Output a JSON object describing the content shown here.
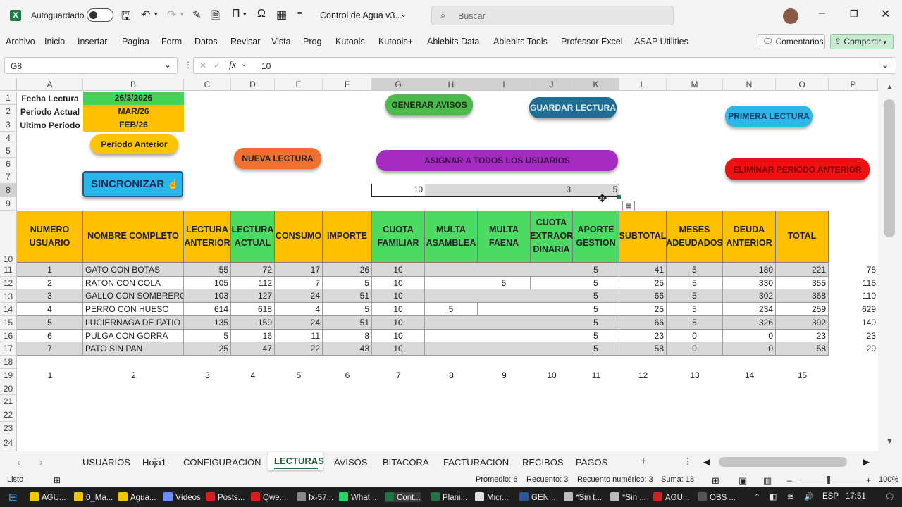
{
  "titlebar": {
    "autosave": "Autoguardado",
    "filename": "Control de Agua v3...",
    "search_placeholder": "Buscar"
  },
  "menu": [
    "Archivo",
    "Inicio",
    "Insertar",
    "Pagina",
    "Form",
    "Datos",
    "Revisar",
    "Vista",
    "Prog",
    "Kutools",
    "Kutools+",
    "Ablebits Data",
    "Ablebits Tools",
    "Professor Excel",
    "ASAP Utilities"
  ],
  "actions": {
    "comments": "Comentarios",
    "share": "Compartir"
  },
  "formula": {
    "cellref": "G8",
    "fx": "fx",
    "value": "10"
  },
  "columns": [
    "A",
    "B",
    "C",
    "D",
    "E",
    "F",
    "G",
    "H",
    "I",
    "J",
    "K",
    "L",
    "M",
    "N",
    "O",
    "P"
  ],
  "rows": [
    "1",
    "2",
    "3",
    "4",
    "5",
    "6",
    "7",
    "8",
    "9",
    "10",
    "11",
    "12",
    "13",
    "14",
    "15",
    "16",
    "17",
    "18",
    "19",
    "20",
    "21",
    "22",
    "23",
    "24"
  ],
  "info": {
    "fecha_label": "Fecha Lectura",
    "fecha": "26/3/2026",
    "periodo_label": "Periodo Actual",
    "periodo": "MAR/26",
    "ultimo_label": "Ultimo Periodo",
    "ultimo": "FEB/26"
  },
  "buttons": {
    "periodo_anterior": "Periodo Anterior",
    "sincronizar": "SINCRONIZAR",
    "nueva_lectura": "NUEVA LECTURA",
    "generar_avisos": "GENERAR AVISOS",
    "asignar": "ASIGNAR A TODOS LOS USUARIOS",
    "guardar": "GUARDAR LECTURA",
    "primera": "PRIMERA LECTURA",
    "eliminar": "ELIMINAR PERIODO ANTERIOR"
  },
  "row8": {
    "g": "10",
    "j": "3",
    "k": "5"
  },
  "headers": {
    "numero": "NUMERO USUARIO",
    "nombre": "NOMBRE COMPLETO",
    "anterior": "LECTURA ANTERIOR",
    "actual": "LECTURA ACTUAL",
    "consumo": "CONSUMO",
    "importe": "IMPORTE",
    "cuota": "CUOTA FAMILIAR",
    "multa_asamblea": "MULTA ASAMBLEA",
    "multa_faena": "MULTA FAENA",
    "cuota_extra": "CUOTA EXTRAOR DINARIA",
    "aporte": "APORTE GESTION",
    "subtotal": "SUBTOTAL",
    "meses": "MESES ADEUDADOS",
    "deuda": "DEUDA ANTERIOR",
    "total": "TOTAL"
  },
  "data": [
    {
      "n": "1",
      "nombre": "GATO CON BOTAS",
      "ant": "55",
      "act": "72",
      "cons": "17",
      "imp": "26",
      "cuota": "10",
      "masam": "",
      "mfaena": "",
      "cextra": "",
      "aporte": "5",
      "sub": "41",
      "meses": "5",
      "deuda": "180",
      "total": "221",
      "p": "78"
    },
    {
      "n": "2",
      "nombre": "RATON CON COLA",
      "ant": "105",
      "act": "112",
      "cons": "7",
      "imp": "5",
      "cuota": "10",
      "masam": "",
      "mfaena": "5",
      "cextra": "",
      "aporte": "5",
      "sub": "25",
      "meses": "5",
      "deuda": "330",
      "total": "355",
      "p": "115"
    },
    {
      "n": "3",
      "nombre": "GALLO CON SOMBRERO",
      "ant": "103",
      "act": "127",
      "cons": "24",
      "imp": "51",
      "cuota": "10",
      "masam": "",
      "mfaena": "",
      "cextra": "",
      "aporte": "5",
      "sub": "66",
      "meses": "5",
      "deuda": "302",
      "total": "368",
      "p": "110"
    },
    {
      "n": "4",
      "nombre": "PERRO CON HUESO",
      "ant": "614",
      "act": "618",
      "cons": "4",
      "imp": "5",
      "cuota": "10",
      "masam": "5",
      "mfaena": "",
      "cextra": "",
      "aporte": "5",
      "sub": "25",
      "meses": "5",
      "deuda": "234",
      "total": "259",
      "p": "629"
    },
    {
      "n": "5",
      "nombre": "LUCIERNAGA DE PATIO",
      "ant": "135",
      "act": "159",
      "cons": "24",
      "imp": "51",
      "cuota": "10",
      "masam": "",
      "mfaena": "",
      "cextra": "",
      "aporte": "5",
      "sub": "66",
      "meses": "5",
      "deuda": "326",
      "total": "392",
      "p": "140"
    },
    {
      "n": "6",
      "nombre": "PULGA CON GORRA",
      "ant": "5",
      "act": "16",
      "cons": "11",
      "imp": "8",
      "cuota": "10",
      "masam": "",
      "mfaena": "",
      "cextra": "",
      "aporte": "5",
      "sub": "23",
      "meses": "0",
      "deuda": "0",
      "total": "23",
      "p": "23"
    },
    {
      "n": "7",
      "nombre": "PATO SIN PAN",
      "ant": "25",
      "act": "47",
      "cons": "22",
      "imp": "43",
      "cuota": "10",
      "masam": "",
      "mfaena": "",
      "cextra": "",
      "aporte": "5",
      "sub": "58",
      "meses": "0",
      "deuda": "0",
      "total": "58",
      "p": "29"
    }
  ],
  "row19": [
    "1",
    "2",
    "3",
    "4",
    "5",
    "6",
    "7",
    "8",
    "9",
    "10",
    "11",
    "12",
    "13",
    "14",
    "15"
  ],
  "sheets": [
    "USUARIOS",
    "Hoja1",
    "CONFIGURACION",
    "LECTURAS",
    "AVISOS",
    "BITACORA",
    "FACTURACION",
    "RECIBOS",
    "PAGOS"
  ],
  "status": {
    "ready": "Listo",
    "promedio": "Promedio: 6",
    "recuento": "Recuento: 3",
    "recuento_num": "Recuento numérico: 3",
    "suma": "Suma: 18",
    "zoom": "100%"
  },
  "taskbar": [
    "AGU...",
    "0_Ma...",
    "Agua...",
    "Vídeos",
    "Posts...",
    "Qwe...",
    "fx-57...",
    "What...",
    "Cont...",
    "Plani...",
    "Micr...",
    "GEN...",
    "*Sin t...",
    "*Sin ...",
    "AGU...",
    "OBS ..."
  ],
  "tray": {
    "lang": "ESP",
    "time": "17:51"
  },
  "colors": {
    "excel_green": "#217346",
    "header_yellow": "#ffc000",
    "header_green": "#4cd964",
    "row_gray": "#d9d9d9",
    "info_green": "#44d25c"
  }
}
